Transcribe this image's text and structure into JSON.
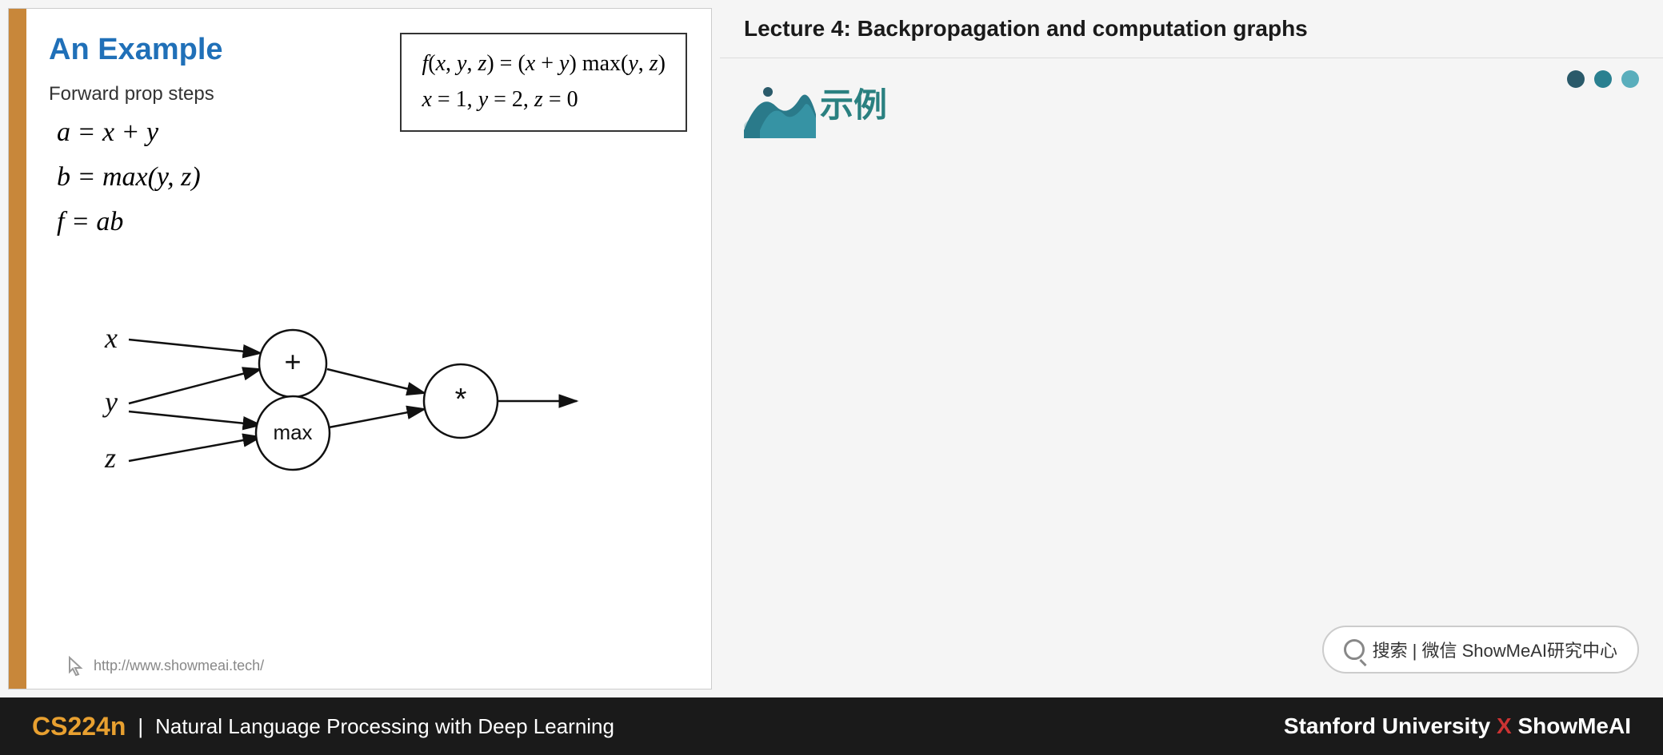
{
  "header": {
    "lecture_title": "Lecture 4:  Backpropagation and computation graphs"
  },
  "slide": {
    "title": "An Example",
    "formula_line1": "f(x, y, z) = (x + y) max(y, z)",
    "formula_line2": "x = 1, y = 2, z = 0",
    "forward_prop_label": "Forward prop steps",
    "math_lines": [
      "a = x + y",
      "b = max(y, z)",
      "f = ab"
    ],
    "footer_url": "http://www.showmeai.tech/"
  },
  "right_panel": {
    "chinese_title": "示例",
    "dots": [
      "dark",
      "medium",
      "light"
    ]
  },
  "search": {
    "text": "搜索 | 微信 ShowMeAI研究中心"
  },
  "bottom_bar": {
    "course_code": "CS224n",
    "separator": "|",
    "course_name": "Natural Language Processing with Deep Learning",
    "university": "Stanford University",
    "x": "X",
    "brand": "ShowMeAI"
  }
}
